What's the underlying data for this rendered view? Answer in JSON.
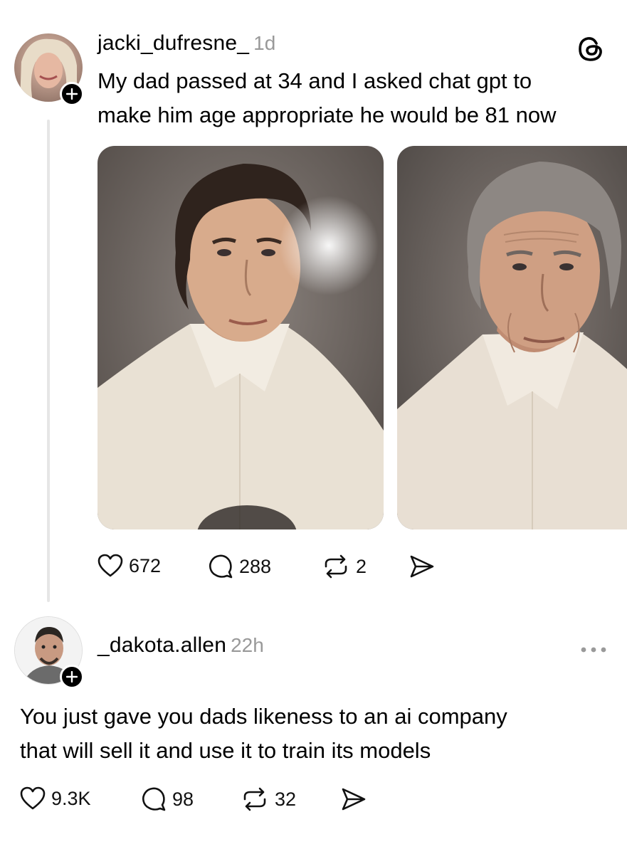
{
  "post": {
    "username": "jacki_dufresne_",
    "time": "1d",
    "text_line1": "My dad passed at 34 and I asked chat gpt to",
    "text_line2": "make him age appropriate he would be 81 now",
    "likes": "672",
    "replies": "288",
    "reposts": "2"
  },
  "reply": {
    "username": "_dakota.allen",
    "time": "22h",
    "text_line1": "You just gave you dads likeness to an ai company",
    "text_line2": "that will sell it and use it to train its models",
    "likes": "9.3K",
    "replies": "98",
    "reposts": "32"
  },
  "icons": {
    "brand": "threads-logo-icon",
    "more": "more-options-icon",
    "like": "heart-icon",
    "reply": "comment-bubble-icon",
    "repost": "repost-icon",
    "share": "send-icon",
    "follow": "plus-icon"
  }
}
